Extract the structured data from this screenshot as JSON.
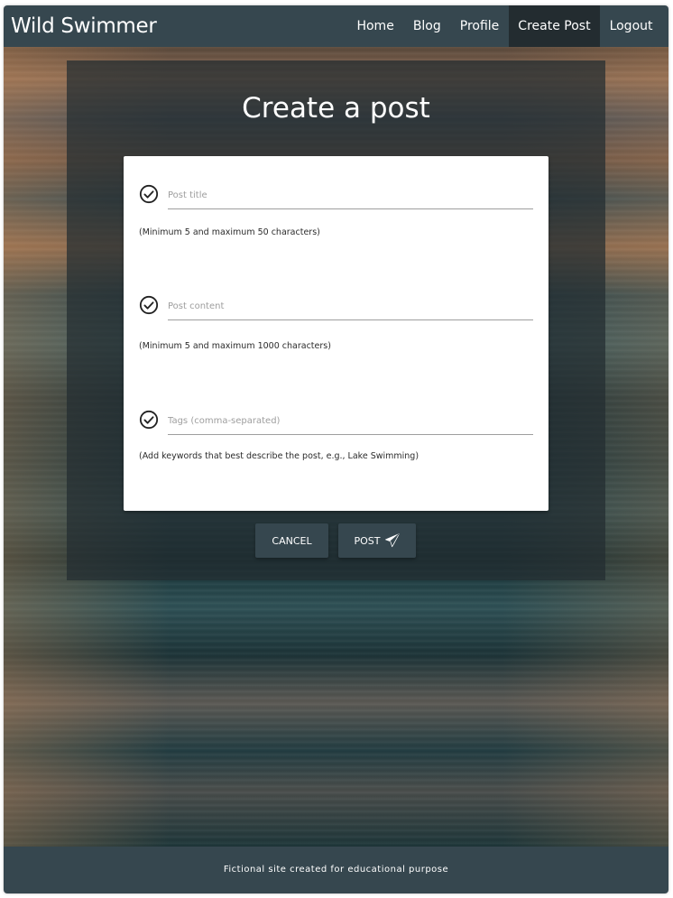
{
  "navbar": {
    "brand": "Wild Swimmer",
    "items": [
      {
        "label": "Home",
        "active": false
      },
      {
        "label": "Blog",
        "active": false
      },
      {
        "label": "Profile",
        "active": false
      },
      {
        "label": "Create Post",
        "active": true
      },
      {
        "label": "Logout",
        "active": false
      }
    ]
  },
  "page": {
    "title": "Create a post"
  },
  "form": {
    "title_field": {
      "placeholder": "Post title",
      "value": "",
      "hint": "(Minimum 5 and maximum 50 characters)",
      "icon": "check-circle-icon"
    },
    "content_field": {
      "placeholder": "Post content",
      "value": "",
      "hint": "(Minimum 5 and maximum 1000 characters)",
      "icon": "check-circle-icon"
    },
    "tags_field": {
      "placeholder": "Tags (comma-separated)",
      "value": "",
      "hint": "(Add keywords that best describe the post, e.g., Lake Swimming)",
      "icon": "check-circle-icon"
    }
  },
  "buttons": {
    "cancel_label": "CANCEL",
    "post_label": "POST",
    "post_icon": "paper-plane-icon"
  },
  "footer": {
    "text": "Fictional site created for educational purpose"
  },
  "colors": {
    "primary": "#36474f",
    "active_nav": "#232c30",
    "card": "#ffffff"
  }
}
